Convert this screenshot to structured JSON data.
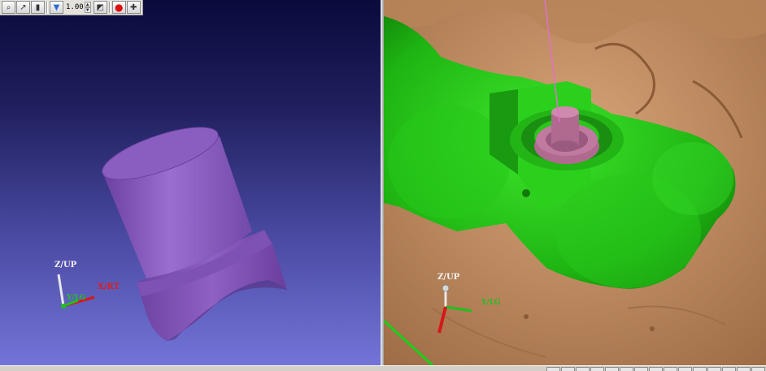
{
  "toolbar": {
    "buttons": [
      "zoom-fit",
      "select",
      "film",
      "view-toggle"
    ],
    "scale_value": "1.00",
    "extra_buttons": [
      "crop",
      "stop",
      "add"
    ]
  },
  "left_view": {
    "axis": {
      "z_label": "Z/UP",
      "x_label": "X/RT",
      "y_label": "Y/LG"
    }
  },
  "right_view": {
    "axis": {
      "z_label": "Z/UP",
      "y_label": "Y/LG"
    }
  },
  "colors": {
    "abutment_purple": "#8a5ec0",
    "gum_green": "#22c414",
    "jaw_tan": "#c99468",
    "implant_pink": "#b06a90"
  }
}
